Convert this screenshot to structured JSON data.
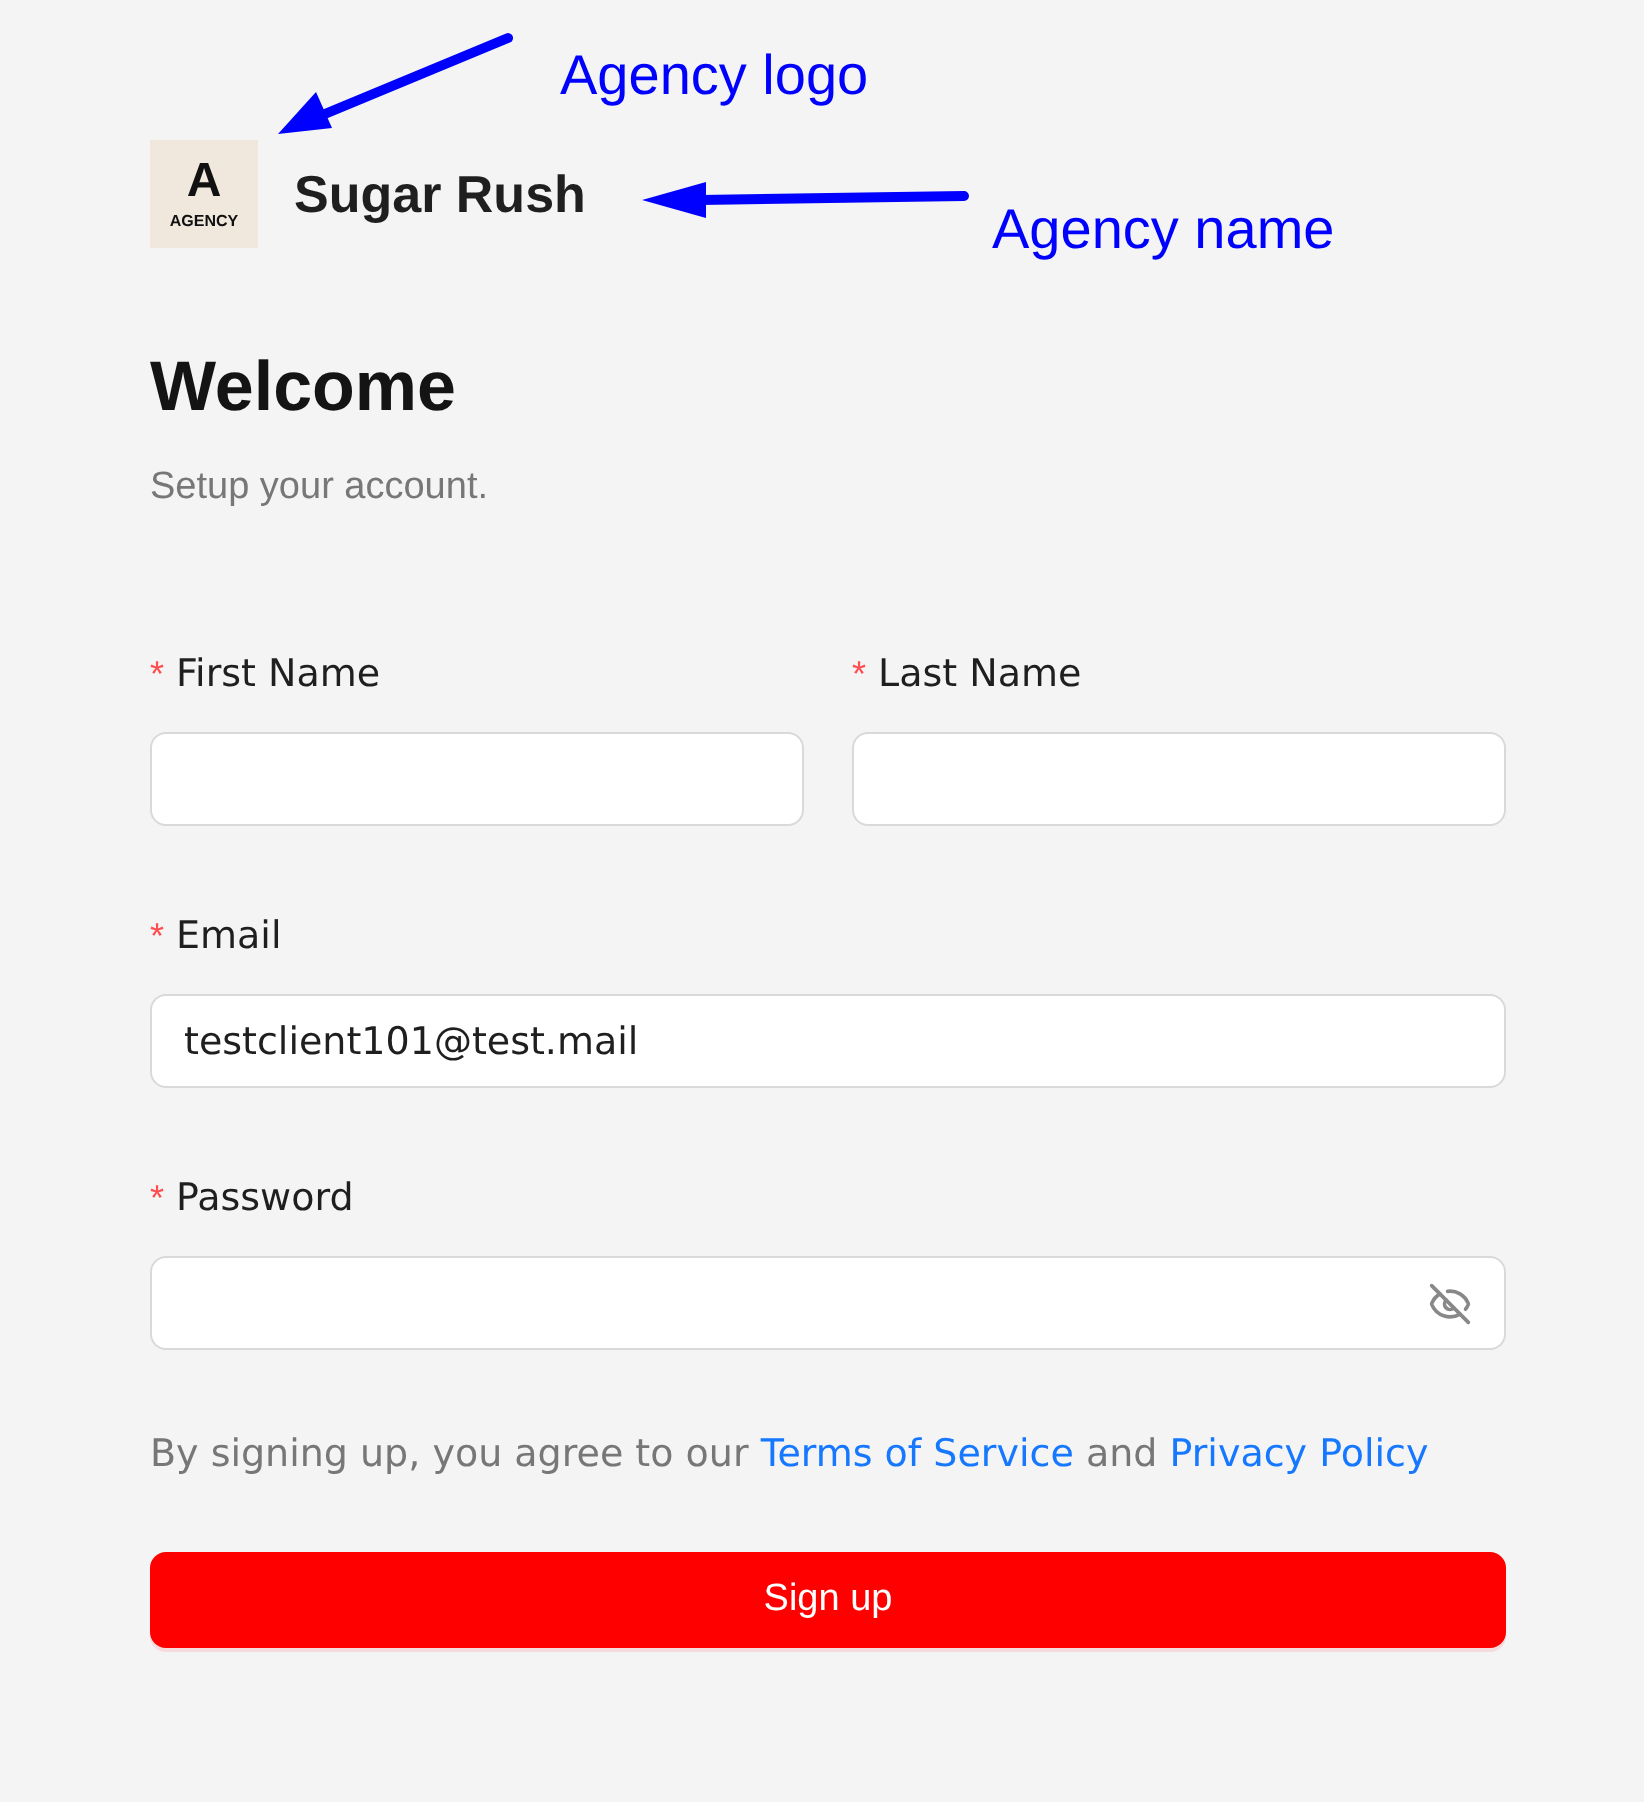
{
  "brand": {
    "logo": {
      "letter": "A",
      "caption": "AGENCY"
    },
    "name": "Sugar Rush"
  },
  "title": "Welcome",
  "subtitle": "Setup your account.",
  "name_fields": [
    {
      "label": "First Name",
      "required_mark": "*"
    },
    {
      "label": "Last Name",
      "required_mark": "*"
    }
  ],
  "email": {
    "label": "Email",
    "required_mark": "*",
    "value": "testclient101@test.mail"
  },
  "password": {
    "label": "Password",
    "required_mark": "*",
    "visible": false
  },
  "consent": {
    "text": "By signing up, you agree to our",
    "terms_link": "Terms of Service",
    "joiner": "and",
    "privacy_link": "Privacy Policy"
  },
  "submit": "Sign up",
  "annotations": [
    {
      "kind": "logo",
      "text": "Agency logo"
    },
    {
      "kind": "name",
      "text": "Agency name"
    }
  ]
}
